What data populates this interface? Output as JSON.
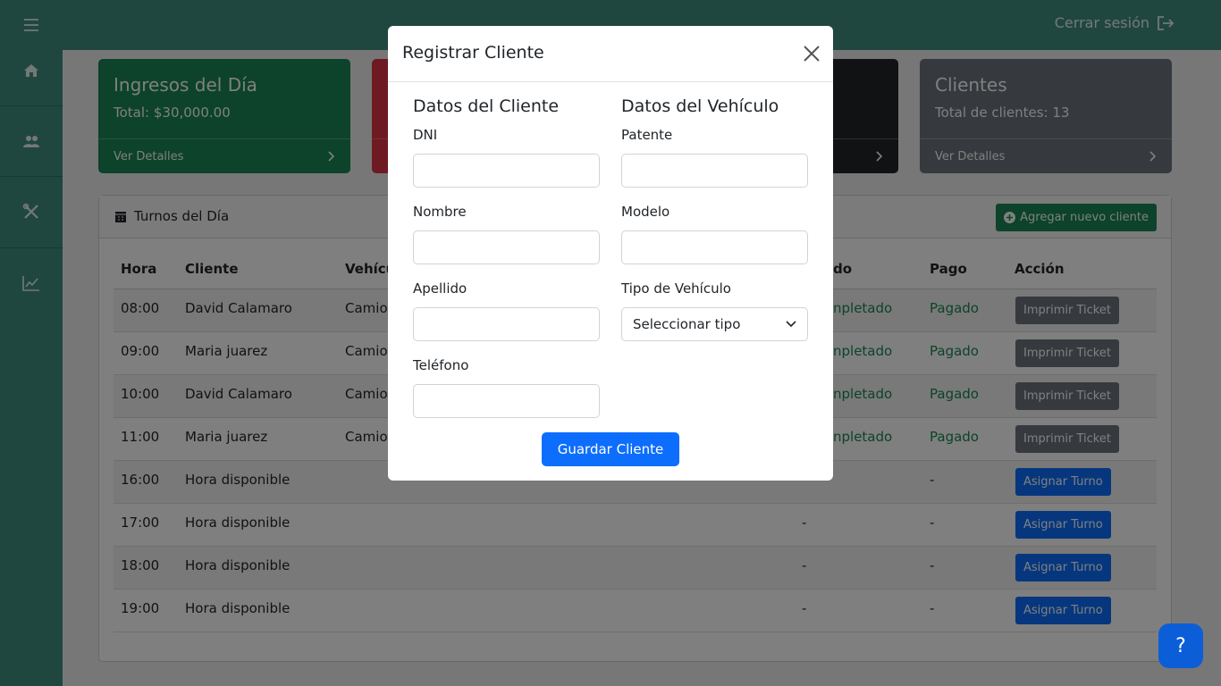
{
  "topbar": {
    "logout_label": "Cerrar sesión"
  },
  "sidebar": {
    "items": [
      "menu-icon",
      "home-icon",
      "users-icon",
      "tools-icon",
      "chart-icon"
    ]
  },
  "cards": [
    {
      "title": "Ingresos del Día",
      "subtitle": "Total: $30,000.00",
      "footer": "Ver Detalles"
    },
    {
      "title": "",
      "subtitle": "",
      "footer": ""
    },
    {
      "title": "",
      "subtitle": "",
      "footer": ""
    },
    {
      "title": "Clientes",
      "subtitle": "Total de clientes: 13",
      "footer": "Ver Detalles"
    }
  ],
  "turnos": {
    "title": "Turnos del Día",
    "add_button": "Agregar nuevo cliente",
    "headers": {
      "hora": "Hora",
      "cliente": "Cliente",
      "vehiculo": "Vehícu",
      "estado": "do",
      "pago": "Pago",
      "accion": "Acción"
    },
    "rows": [
      {
        "hora": "08:00",
        "cliente": "David Calamaro",
        "vehiculo": "Camio",
        "estado": "npletado",
        "pago": "Pagado",
        "accion": "Imprimir Ticket"
      },
      {
        "hora": "09:00",
        "cliente": "Maria juarez",
        "vehiculo": "Camio",
        "estado": "npletado",
        "pago": "Pagado",
        "accion": "Imprimir Ticket"
      },
      {
        "hora": "10:00",
        "cliente": "David Calamaro",
        "vehiculo": "Camio",
        "estado": "npletado",
        "pago": "Pagado",
        "accion": "Imprimir Ticket"
      },
      {
        "hora": "11:00",
        "cliente": "Maria juarez",
        "vehiculo": "Camio",
        "estado": "npletado",
        "pago": "Pagado",
        "accion": "Imprimir Ticket"
      },
      {
        "hora": "16:00",
        "cliente": "Hora disponible",
        "vehiculo": "",
        "estado": "",
        "pago": "-",
        "accion": "Asignar Turno"
      },
      {
        "hora": "17:00",
        "cliente": "Hora disponible",
        "vehiculo": "",
        "estado": "-",
        "pago": "-",
        "accion": "Asignar Turno"
      },
      {
        "hora": "18:00",
        "cliente": "Hora disponible",
        "vehiculo": "",
        "estado": "-",
        "pago": "-",
        "accion": "Asignar Turno"
      },
      {
        "hora": "19:00",
        "cliente": "Hora disponible",
        "vehiculo": "",
        "estado": "-",
        "pago": "-",
        "accion": "Asignar Turno"
      }
    ]
  },
  "modal": {
    "title": "Registrar Cliente",
    "cliente_section": "Datos del Cliente",
    "vehiculo_section": "Datos del Vehículo",
    "fields": {
      "dni": "DNI",
      "nombre": "Nombre",
      "apellido": "Apellido",
      "telefono": "Teléfono",
      "patente": "Patente",
      "modelo": "Modelo",
      "tipo": "Tipo de Vehículo"
    },
    "tipo_selected": "Seleccionar tipo",
    "save_button": "Guardar Cliente"
  },
  "help_label": "?"
}
